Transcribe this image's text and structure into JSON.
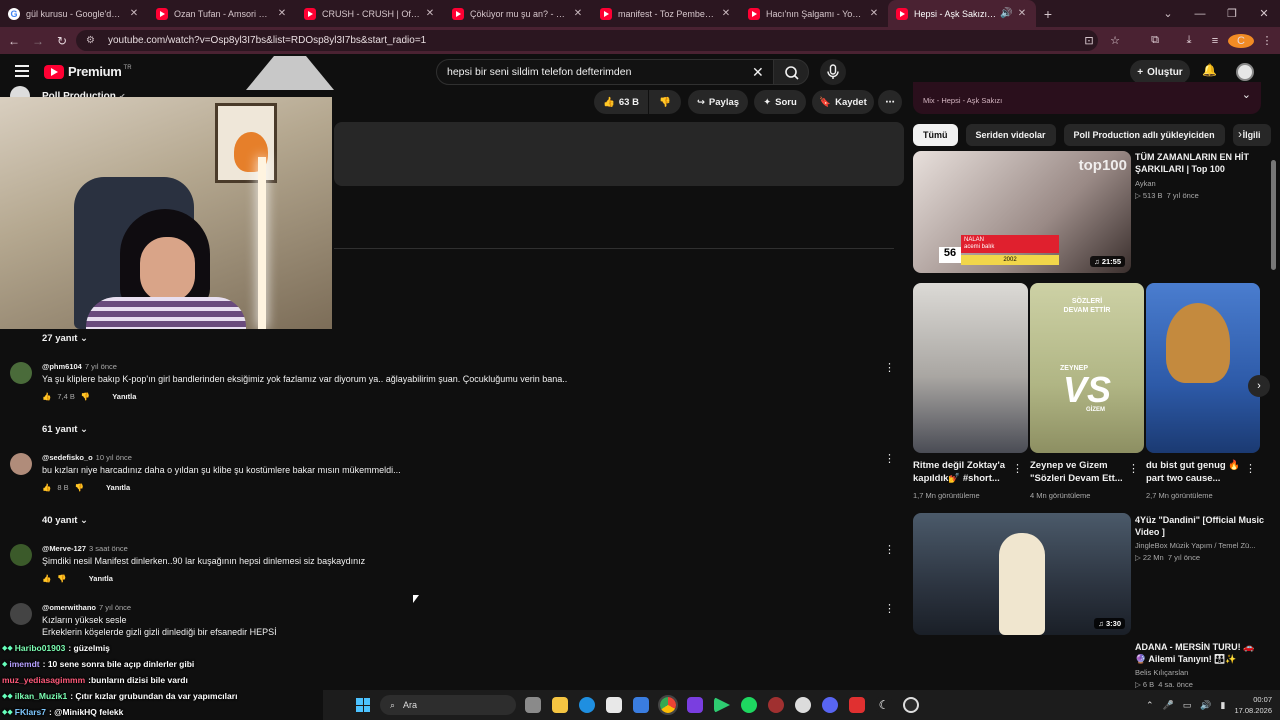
{
  "browser": {
    "tabs": [
      {
        "title": "gül kurusu - Google'da Ara",
        "favicon": "google-icon"
      },
      {
        "title": "Ozan Tufan - Amsori Heel...",
        "favicon": "youtube-icon"
      },
      {
        "title": "CRUSH - CRUSH | Official Music",
        "favicon": "youtube-icon"
      },
      {
        "title": "Çöküyor mu şu an? - YouTube",
        "favicon": "youtube-icon"
      },
      {
        "title": "manifest - Toz Pembe | Official",
        "favicon": "youtube-icon"
      },
      {
        "title": "Hacı'nın Şalgamı - YouTube",
        "favicon": "youtube-icon"
      },
      {
        "title": "Hepsi - Aşk Sakızı - YouTube",
        "favicon": "youtube-icon",
        "active": true
      }
    ],
    "url": "youtube.com/watch?v=Osp8yl3I7bs&list=RDOsp8yl3I7bs&start_radio=1",
    "profile_initial": "C"
  },
  "youtube": {
    "logo_text": "Premium",
    "logo_country": "TR",
    "search_value": "hepsi bir seni sildim telefon defterimden",
    "create_label": "Oluştur",
    "channel_name": "Poll Production",
    "actions": {
      "like_count": "63 B",
      "share_label": "Paylaş",
      "ask_label": "Soru",
      "save_label": "Kaydet"
    }
  },
  "comments": {
    "reply_label": "Yanıtla",
    "items": [
      {
        "replies": "27 yanıt"
      },
      {
        "handle": "@phm6104",
        "age": "7 yıl önce",
        "text": "Ya şu kliplere bakıp K-pop'ın girl bandlerinden eksiğimiz yok fazlamız var diyorum ya.. ağlayabilirim şuan. Çocukluğumu verin bana..",
        "likes": "7,4 B",
        "replies": "61 yanıt"
      },
      {
        "handle": "@sedefisko_o",
        "age": "10 yıl önce",
        "text": "bu kızları niye harcadınız daha o yıldan şu klibe şu kostümlere bakar mısın mükemmeldi...",
        "likes": "8 B",
        "replies": "40 yanıt"
      },
      {
        "handle": "@Merve-127",
        "age": "3 saat önce",
        "text": "Şimdiki nesil Manifest dinlerken..90 lar kuşağının hepsi dinlemesi siz başkaydınız",
        "likes": ""
      },
      {
        "handle": "@omerwithano",
        "age": "7 yıl önce",
        "text": "Kızların yüksek sesle",
        "text2": "Erkeklerin köşelerde gizli gizli dinlediği bir efsanedir HEPSİ"
      }
    ]
  },
  "sidebar": {
    "mix_subtitle": "Mix - Hepsi - Aşk Sakızı",
    "chips": [
      "Tümü",
      "Seriden videolar",
      "Poll Production adlı yükleyiciden",
      "İlgili"
    ],
    "videos": [
      {
        "title": "TÜM ZAMANLARIN EN HİT ŞARKILARI | Top 100",
        "channel": "Aykan",
        "views": "513 B",
        "age": "7 yıl önce",
        "duration": "21:55"
      },
      {
        "title": "4Yüz \"Dandini\" [Official Music Video ]",
        "channel": "JingleBox Müzik Yapım / Temel Zü...",
        "views": "22 Mn",
        "age": "7 yıl önce",
        "duration": "3:30"
      },
      {
        "title": "ADANA - MERSİN TURU! 🚗🔮 Ailemi Tanıyın! 👪✨",
        "channel": "Belis Kılıçarslan",
        "views": "6 B",
        "age": "4 sa. önce"
      }
    ],
    "shorts": [
      {
        "title": "Ritme değil Zoktay'a kapıldık💅 #short...",
        "views": "1,7 Mn görüntüleme"
      },
      {
        "title": "Zeynep ve Gizem \"Sözleri Devam Ett...",
        "views": "4 Mn görüntüleme"
      },
      {
        "title": "du bist gut genug 🔥 part two cause...",
        "views": "2,7 Mn görüntüleme"
      }
    ],
    "thumb_top100_label": "top100",
    "thumb_top100_rank": "56",
    "thumb_top100_artist": "NALAN",
    "thumb_top100_song": "acemi balık",
    "thumb_top100_year": "2002",
    "short2_overlay": "SÖZLERİ DEVAM ETTİR",
    "short2_vs": "VS",
    "short2_left": "ZEYNEP",
    "short2_right": "GİZEM"
  },
  "chat": [
    {
      "user": "Haribo01903",
      "msg": ": güzelmiş",
      "color": "#7cffb3"
    },
    {
      "user": "imemdt",
      "msg": ": 10 sene sonra bile açıp dinlerler gibi",
      "color": "#b7a0ff"
    },
    {
      "user": "muz_yediasagimmm",
      "msg": ":bunların dizisi bile vardı",
      "color": "#ff5a7a"
    },
    {
      "user": "ilkan_Muzik1",
      "msg": ": Çıtır kızlar grubundan da var yapımcıları",
      "color": "#7cffb3"
    },
    {
      "user": "FKlars7",
      "msg": ": @MinikHQ felekk",
      "color": "#7ec8ff"
    }
  ],
  "taskbar": {
    "search_placeholder": "Ara",
    "time": "00:07",
    "date": "17.08.2026"
  },
  "colors": {
    "accent_red": "#ff0033",
    "browser_frame": "#4a2232",
    "page_bg": "#0f0f0f"
  }
}
